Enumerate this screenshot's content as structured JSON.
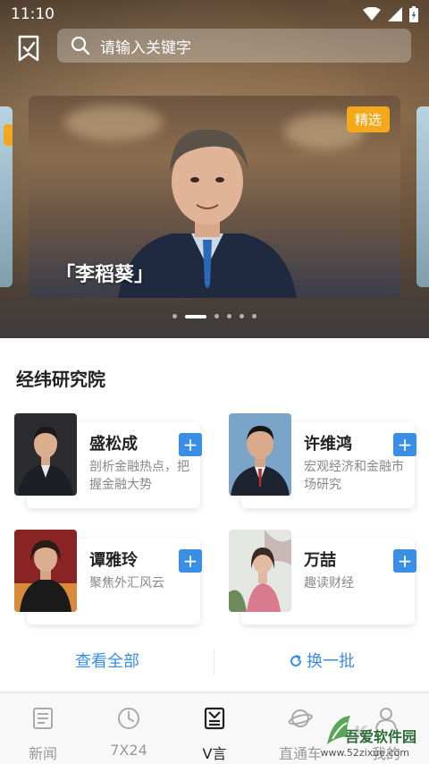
{
  "status_bar": {
    "time": "11:10"
  },
  "search": {
    "placeholder": "请输入关键字"
  },
  "carousel": {
    "badge": "精选",
    "caption": "「李稻葵」",
    "dot_count": 6,
    "active_index": 1
  },
  "section": {
    "title": "经纬研究院"
  },
  "experts": [
    {
      "name": "盛松成",
      "desc": "剖析金融热点，把握金融大势"
    },
    {
      "name": "许维鸿",
      "desc": "宏观经济和金融市场研究"
    },
    {
      "name": "谭雅玲",
      "desc": "聚焦外汇风云"
    },
    {
      "name": "万喆",
      "desc": "趣读财经"
    }
  ],
  "actions": {
    "view_all": "查看全部",
    "refresh": "换一批",
    "add_symbol": "+"
  },
  "tabs": [
    {
      "label": "新闻",
      "icon": "news-icon"
    },
    {
      "label": "7X24",
      "icon": "clock-icon"
    },
    {
      "label": "V言",
      "icon": "v-column-icon"
    },
    {
      "label": "直通车",
      "icon": "planet-icon"
    },
    {
      "label": "我的",
      "icon": "user-icon"
    }
  ],
  "watermark": {
    "text": "吾爱软件园",
    "url": "www.52zixue.com"
  },
  "colors": {
    "accent": "#3a8ee6",
    "badge": "#f5a81a"
  }
}
